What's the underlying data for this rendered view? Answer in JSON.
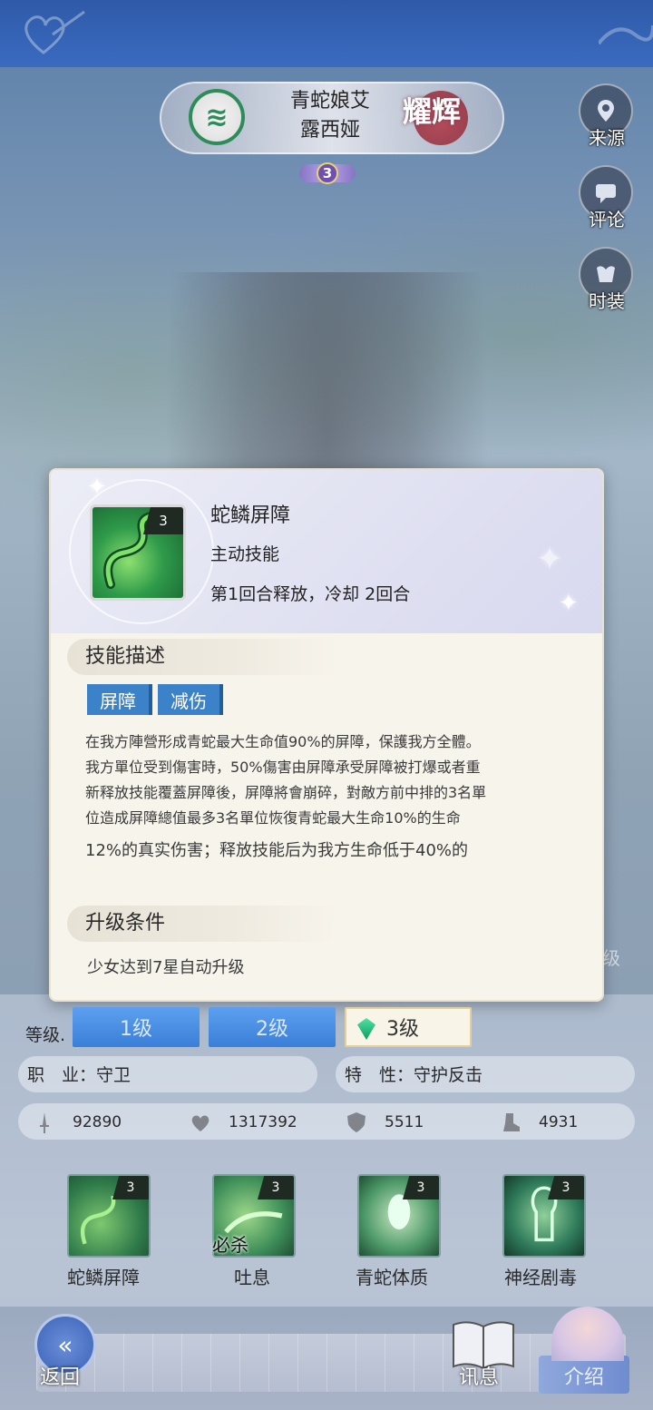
{
  "header": {
    "character_name_line1": "青蛇娘艾",
    "character_name_line2": "露西娅",
    "rarity_label": "耀辉",
    "star_count": "3"
  },
  "side_buttons": [
    {
      "label": "来源",
      "icon": "location-pin-icon"
    },
    {
      "label": "评论",
      "icon": "chat-bubble-icon"
    },
    {
      "label": "时装",
      "icon": "costume-icon"
    }
  ],
  "popup": {
    "skill_name": "蛇鳞屏障",
    "skill_level": "3",
    "skill_type": "主动技能",
    "cooldown": "第1回合释放，冷却 2回合",
    "desc_title": "技能描述",
    "tags": [
      "屏障",
      "减伤"
    ],
    "desc_lines": [
      "在我方陣營形成青蛇最大生命值90%的屏障，保護我方全體。",
      "我方單位受到傷害時，50%傷害由屏障承受屏障被打爆或者重",
      "新释放技能覆蓋屏障後，屏障將會崩碎，對敵方前中排的3名單",
      "位造成屏障總值最多3名單位恢復青蛇最大生命10%的生命",
      "12%的真实伤害；释放技能后为我方生命低于40%的"
    ],
    "upgrade_title": "升级条件",
    "upgrade_text": "少女达到7星自动升级"
  },
  "level_row": {
    "label": "等级.",
    "levels": [
      "1级",
      "2级",
      "3级"
    ],
    "selected": "3级"
  },
  "profile": {
    "job": "职　业：守卫",
    "trait": "特　性：守护反击"
  },
  "stats": [
    {
      "icon": "sword-icon",
      "value": "92890"
    },
    {
      "icon": "heart-icon",
      "value": "1317392"
    },
    {
      "icon": "shield-icon",
      "value": "5511"
    },
    {
      "icon": "boot-icon",
      "value": "4931"
    }
  ],
  "skills": [
    {
      "name": "蛇鳞屏障",
      "level": "3"
    },
    {
      "name": "吐息",
      "level": "3",
      "badge": "必杀"
    },
    {
      "name": "青蛇体质",
      "level": "3"
    },
    {
      "name": "神经剧毒",
      "level": "3"
    }
  ],
  "bottom_nav": {
    "back": "返回",
    "message": "讯息",
    "intro": "介绍"
  },
  "right_edge_glimpse": "级",
  "colors": {
    "tag_blue": "#3b82c9",
    "level_button_blue": "#3a7fd8",
    "faction_green": "#2e8c5a",
    "popup_bg": "#f7f4ec"
  }
}
